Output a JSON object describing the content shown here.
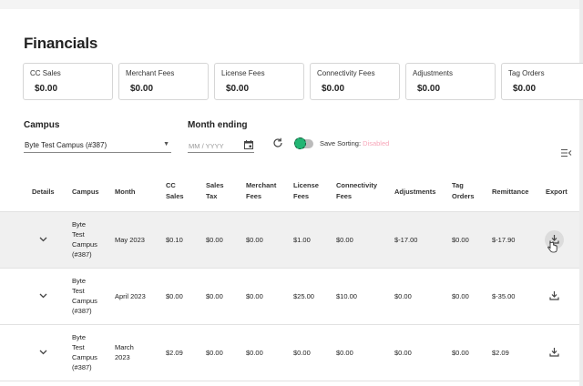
{
  "page": {
    "title": "Financials"
  },
  "summary_cards": [
    {
      "label": "CC Sales",
      "value": "$0.00"
    },
    {
      "label": "Merchant Fees",
      "value": "$0.00"
    },
    {
      "label": "License Fees",
      "value": "$0.00"
    },
    {
      "label": "Connectivity Fees",
      "value": "$0.00"
    },
    {
      "label": "Adjustments",
      "value": "$0.00"
    },
    {
      "label": "Tag Orders",
      "value": "$0.00"
    }
  ],
  "filters": {
    "campus_label": "Campus",
    "campus_value": "Byte Test Campus (#387)",
    "month_label": "Month ending",
    "month_placeholder": "MM / YYYY",
    "save_sorting_label": "Save Sorting:",
    "save_sorting_value": "Disabled",
    "save_sorting_enabled": false
  },
  "icons": {
    "refresh": "refresh-icon",
    "calendar": "calendar-icon",
    "dropdown": "caret-down-icon",
    "columns": "column-menu-icon",
    "expand": "chevron-down-icon",
    "export": "download-icon"
  },
  "table": {
    "headers": {
      "details": "Details",
      "campus": "Campus",
      "month": "Month",
      "cc_sales_1": "CC",
      "cc_sales_2": "Sales",
      "sales_tax_1": "Sales",
      "sales_tax_2": "Tax",
      "merchant_fees_1": "Merchant",
      "merchant_fees_2": "Fees",
      "license_fees_1": "License",
      "license_fees_2": "Fees",
      "connectivity_fees_1": "Connectivity",
      "connectivity_fees_2": "Fees",
      "adjustments": "Adjustments",
      "tag_orders_1": "Tag",
      "tag_orders_2": "Orders",
      "remittance": "Remittance",
      "export": "Export"
    },
    "rows": [
      {
        "campus": [
          "Byte",
          "Test",
          "Campus",
          "(#387)"
        ],
        "month": [
          "May 2023"
        ],
        "cc_sales": "$0.10",
        "sales_tax": "$0.00",
        "merchant_fees": "$0.00",
        "license_fees": "$1.00",
        "connectivity_fees": "$0.00",
        "adjustments": "$-17.00",
        "tag_orders": "$0.00",
        "remittance": "$-17.90",
        "highlighted": true
      },
      {
        "campus": [
          "Byte",
          "Test",
          "Campus",
          "(#387)"
        ],
        "month": [
          "April 2023"
        ],
        "cc_sales": "$0.00",
        "sales_tax": "$0.00",
        "merchant_fees": "$0.00",
        "license_fees": "$25.00",
        "connectivity_fees": "$10.00",
        "adjustments": "$0.00",
        "tag_orders": "$0.00",
        "remittance": "$-35.00",
        "highlighted": false
      },
      {
        "campus": [
          "Byte",
          "Test",
          "Campus",
          "(#387)"
        ],
        "month": [
          "March",
          "2023"
        ],
        "cc_sales": "$2.09",
        "sales_tax": "$0.00",
        "merchant_fees": "$0.00",
        "license_fees": "$0.00",
        "connectivity_fees": "$0.00",
        "adjustments": "$0.00",
        "tag_orders": "$0.00",
        "remittance": "$2.09",
        "highlighted": false
      }
    ]
  }
}
